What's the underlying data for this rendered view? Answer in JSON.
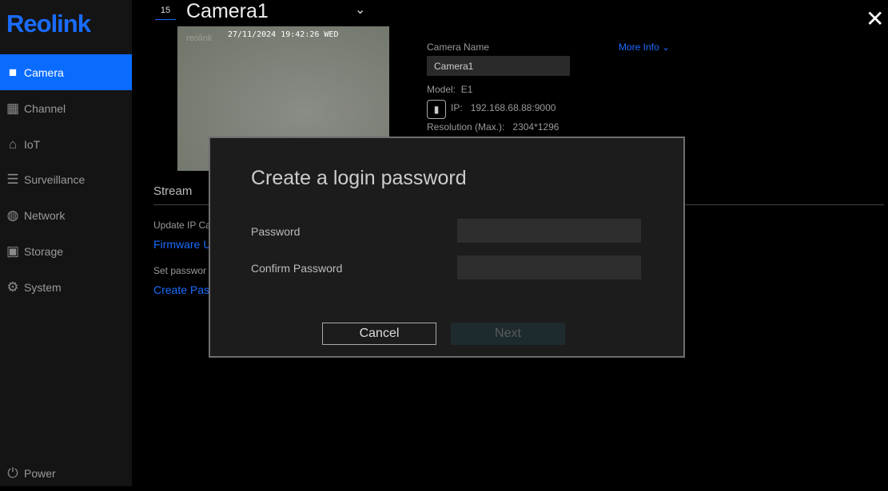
{
  "sidebar": {
    "logo": "Reolink",
    "items": [
      {
        "label": "Camera",
        "icon": "camera-icon"
      },
      {
        "label": "Channel",
        "icon": "grid-icon"
      },
      {
        "label": "IoT",
        "icon": "home-icon"
      },
      {
        "label": "Surveillance",
        "icon": "list-icon"
      },
      {
        "label": "Network",
        "icon": "globe-icon"
      },
      {
        "label": "Storage",
        "icon": "storage-icon"
      },
      {
        "label": "System",
        "icon": "gear-icon"
      }
    ],
    "power": "Power"
  },
  "header": {
    "channel": "15",
    "title": "Camera1"
  },
  "preview": {
    "osd": "27/11/2024 19:42:26 WED",
    "watermark": "reolink"
  },
  "info": {
    "name_label": "Camera Name",
    "name_value": "Camera1",
    "more_info": "More Info",
    "model_label": "Model:",
    "model": "E1",
    "ip_label": "IP:",
    "ip": "192.168.68.88:9000",
    "res_label": "Resolution (Max.):",
    "res": "2304*1296"
  },
  "stream": {
    "title": "Stream",
    "update_label": "Update IP Ca",
    "firmware_link": "Firmware U",
    "set_label": "Set passwor",
    "create_link": "Create Pas"
  },
  "dialog": {
    "title": "Create a login password",
    "password_label": "Password",
    "confirm_label": "Confirm Password",
    "cancel": "Cancel",
    "next": "Next"
  },
  "colors": {
    "accent": "#0a6cff"
  }
}
